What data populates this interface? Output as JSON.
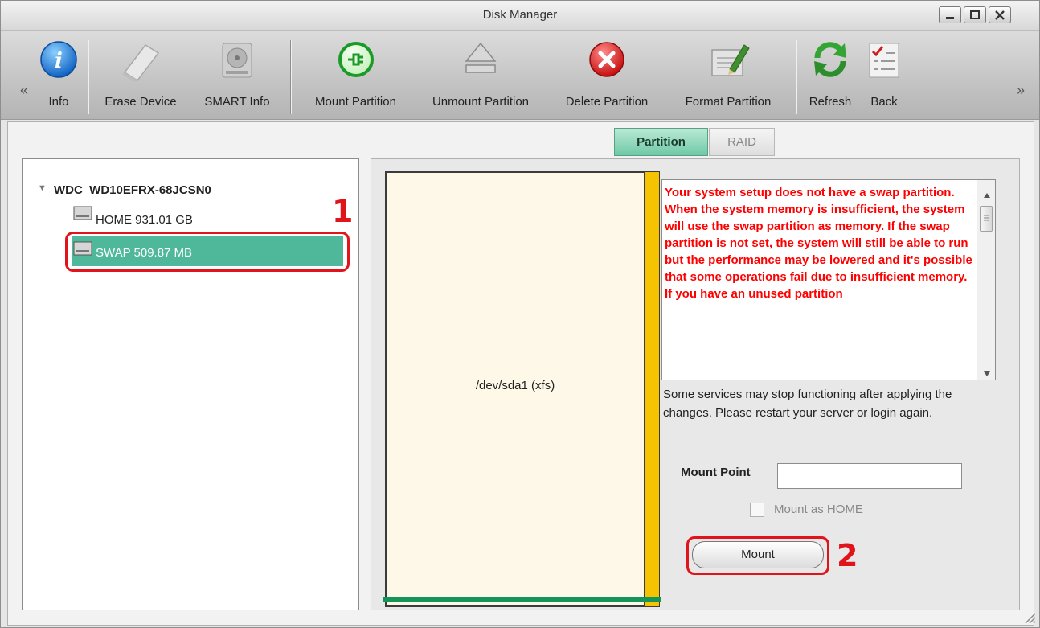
{
  "window": {
    "title": "Disk Manager",
    "buttons": [
      "minimize",
      "maximize",
      "close"
    ]
  },
  "toolbar": {
    "items": [
      {
        "label": "Info",
        "icon": "info-icon"
      },
      {
        "label": "Erase Device",
        "icon": "eraser-icon"
      },
      {
        "label": "SMART Info",
        "icon": "hard-drive-icon"
      },
      {
        "label": "Mount Partition",
        "icon": "plug-icon"
      },
      {
        "label": "Unmount Partition",
        "icon": "eject-icon"
      },
      {
        "label": "Delete Partition",
        "icon": "delete-icon"
      },
      {
        "label": "Format Partition",
        "icon": "format-icon"
      },
      {
        "label": "Refresh",
        "icon": "refresh-icon"
      },
      {
        "label": "Back",
        "icon": "checklist-icon"
      }
    ],
    "prev_glyph": "«",
    "next_glyph": "»"
  },
  "tabs": [
    {
      "label": "Partition",
      "active": true
    },
    {
      "label": "RAID",
      "active": false
    }
  ],
  "tree": {
    "disk": "WDC_WD10EFRX-68JCSN0",
    "expander": "▼",
    "partitions": [
      {
        "label": "HOME 931.01 GB",
        "selected": false
      },
      {
        "label": "SWAP 509.87 MB",
        "selected": true
      }
    ]
  },
  "partition_map": {
    "label": "/dev/sda1 (xfs)"
  },
  "warning": {
    "text": "Your system setup does not have a swap partition. When the system memory is insufficient, the system will use the swap partition as memory. If the swap partition is not set, the system will still be able to run but the performance may be lowered and it's possible that some operations fail due to insufficient memory. If you have an unused partition"
  },
  "notice": "Some services may stop functioning after applying the changes. Please restart your server or login again.",
  "mount_form": {
    "mount_point_label": "Mount Point",
    "mount_point_value": "",
    "mount_home_label": "Mount as HOME",
    "mount_home_checked": false,
    "mount_button": "Mount"
  },
  "callouts": [
    "1",
    "2"
  ],
  "colors": {
    "accent": "#6fc9a6",
    "warning_text": "#ff0000",
    "callout": "#e1141b",
    "partition_bar": "#f5c300",
    "partition_base": "#13955a"
  }
}
